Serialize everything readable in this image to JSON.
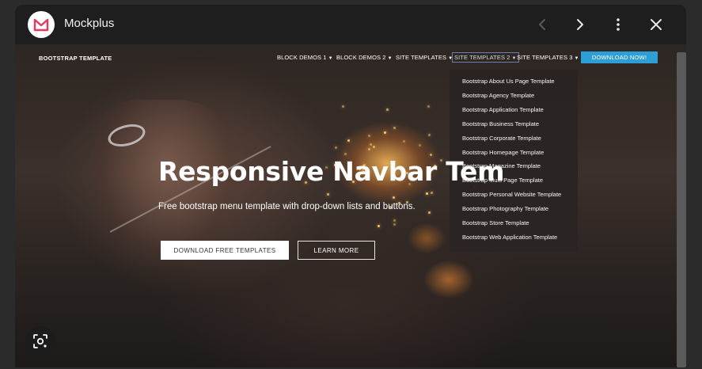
{
  "app": {
    "title": "Mockplus",
    "icons": {
      "logo": "mockplus-logo-icon",
      "back": "chevron-left-icon",
      "forward": "chevron-right-icon",
      "more": "more-vertical-icon",
      "close": "close-icon",
      "lens": "lens-search-icon"
    },
    "colors": {
      "logo_accent": "#e8365d",
      "titlebar": "#1e1e1e",
      "download_button": "#2e9fd6"
    }
  },
  "site": {
    "brand": "BOOTSTRAP TEMPLATE",
    "nav": [
      {
        "label": "BLOCK DEMOS 1"
      },
      {
        "label": "BLOCK DEMOS 2"
      },
      {
        "label": "SITE TEMPLATES"
      },
      {
        "label": "SITE TEMPLATES 2",
        "active": true
      },
      {
        "label": "SITE TEMPLATES 3"
      }
    ],
    "cta": "DOWNLOAD NOW!",
    "dropdown": [
      "Bootstrap About Us Page Template",
      "Bootstrap Agency Template",
      "Bootstrap Application Template",
      "Bootstrap Business Template",
      "Bootstrap Corporate Template",
      "Bootstrap Homepage Template",
      "Bootstrap Magazine Template",
      "Bootstrap Multi Page Template",
      "Bootstrap Personal Website Template",
      "Bootstrap Photography Template",
      "Bootstrap Store Template",
      "Bootstrap Web Application Template"
    ],
    "hero": {
      "title": "Responsive Navbar Tem",
      "subtitle": "Free bootstrap menu template with drop-down lists and buttons.",
      "primary_button": "DOWNLOAD FREE TEMPLATES",
      "secondary_button": "LEARN MORE"
    }
  }
}
